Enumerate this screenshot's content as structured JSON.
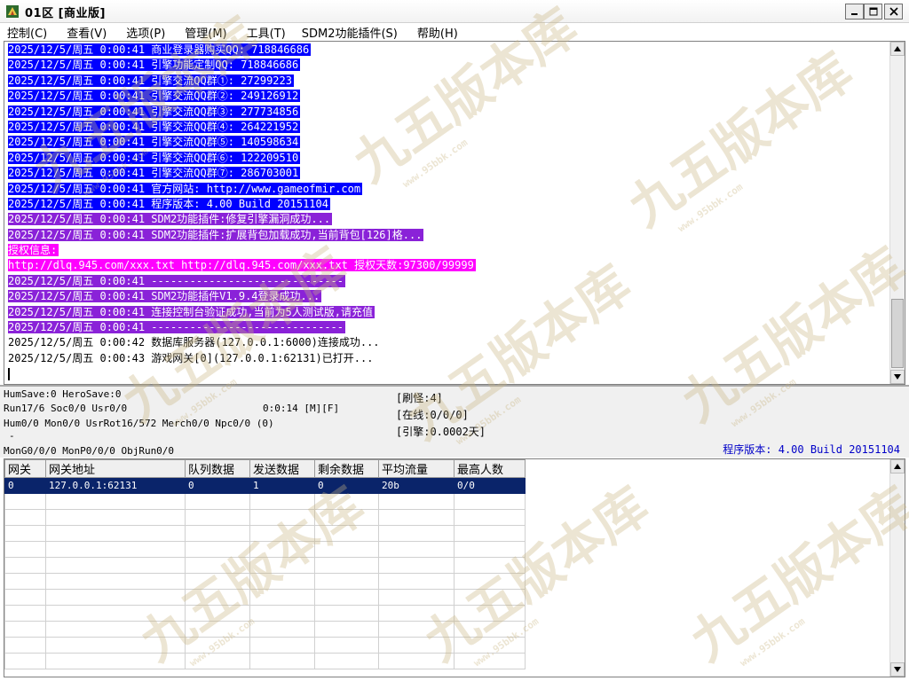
{
  "window": {
    "title": "01区 [商业版]"
  },
  "menu": [
    {
      "label": "控制(C)"
    },
    {
      "label": "查看(V)"
    },
    {
      "label": "选项(P)"
    },
    {
      "label": "管理(M)"
    },
    {
      "label": "工具(T)"
    },
    {
      "label": "SDM2功能插件(S)"
    },
    {
      "label": "帮助(H)"
    }
  ],
  "log": [
    {
      "text": "2025/12/5/周五 0:00:41 商业登录器购买QQ: 718846686",
      "style": "blue"
    },
    {
      "text": "2025/12/5/周五 0:00:41 引擎功能定制QQ: 718846686",
      "style": "blue"
    },
    {
      "text": "2025/12/5/周五 0:00:41 引擎交流QQ群①: 27299223",
      "style": "blue"
    },
    {
      "text": "2025/12/5/周五 0:00:41 引擎交流QQ群②: 249126912",
      "style": "blue"
    },
    {
      "text": "2025/12/5/周五 0:00:41 引擎交流QQ群③: 277734856",
      "style": "blue"
    },
    {
      "text": "2025/12/5/周五 0:00:41 引擎交流QQ群④: 264221952",
      "style": "blue"
    },
    {
      "text": "2025/12/5/周五 0:00:41 引擎交流QQ群⑤: 140598634",
      "style": "blue"
    },
    {
      "text": "2025/12/5/周五 0:00:41 引擎交流QQ群⑥: 122209510",
      "style": "blue"
    },
    {
      "text": "2025/12/5/周五 0:00:41 引擎交流QQ群⑦: 286703001",
      "style": "blue"
    },
    {
      "text": "2025/12/5/周五 0:00:41 官方网站: http://www.gameofmir.com",
      "style": "blue"
    },
    {
      "text": "2025/12/5/周五 0:00:41 程序版本: 4.00 Build 20151104",
      "style": "blue"
    },
    {
      "text": "2025/12/5/周五 0:00:41 SDM2功能插件:修复引擎漏洞成功...",
      "style": "purple"
    },
    {
      "text": "2025/12/5/周五 0:00:41 SDM2功能插件:扩展背包加载成功,当前背包[126]格...",
      "style": "purple"
    },
    {
      "text": "授权信息:",
      "style": "magenta"
    },
    {
      "text": "http://dlq.945.com/xxx.txt http://dlq.945.com/xxx.txt 授权天数:97300/99999",
      "style": "magenta"
    },
    {
      "text": "2025/12/5/周五 0:00:41 ------------------------------",
      "style": "purple"
    },
    {
      "text": "2025/12/5/周五 0:00:41 SDM2功能插件V1.9.4登录成功...",
      "style": "purple"
    },
    {
      "text": "2025/12/5/周五 0:00:41 连接控制台验证成功,当前为5人测试版,请充值",
      "style": "purple"
    },
    {
      "text": "2025/12/5/周五 0:00:41 ------------------------------",
      "style": "purple"
    },
    {
      "text": "2025/12/5/周五 0:00:42 数据库服务器(127.0.0.1:6000)连接成功...",
      "style": "plain"
    },
    {
      "text": "2025/12/5/周五 0:00:43 游戏网关[0](127.0.0.1:62131)已打开...",
      "style": "plain"
    }
  ],
  "status": {
    "line1": "HumSave:0 HeroSave:0",
    "line2": "Run17/6 Soc0/0 Usr0/0",
    "timer": "0:0:14 [M][F]",
    "line3": "Hum0/0 Mon0/0 UsrRot16/572 Merch0/0 Npc0/0 (0)",
    "line4": "-",
    "line5": "MonG0/0/0 MonP0/0/0 ObjRun0/0",
    "refresh": "[刷怪:4]",
    "online": "[在线:0/0/0]",
    "engine": "[引擎:0.0002天]",
    "version": "程序版本: 4.00 Build 20151104"
  },
  "table": {
    "columns": [
      "网关",
      "网关地址",
      "队列数据",
      "发送数据",
      "剩余数据",
      "平均流量",
      "最高人数"
    ],
    "rows": [
      [
        "0",
        "127.0.0.1:62131",
        "0",
        "1",
        "0",
        "20b",
        "0/0"
      ]
    ]
  },
  "watermark": {
    "text": "九五版本库",
    "site": "www.95bbk.com"
  },
  "colors": {
    "highlight_blue": "#0000ff",
    "highlight_purple": "#8a22d8",
    "highlight_magenta": "#ff00ff",
    "selected_row": "#0a246a",
    "version_text": "#0000c8"
  }
}
